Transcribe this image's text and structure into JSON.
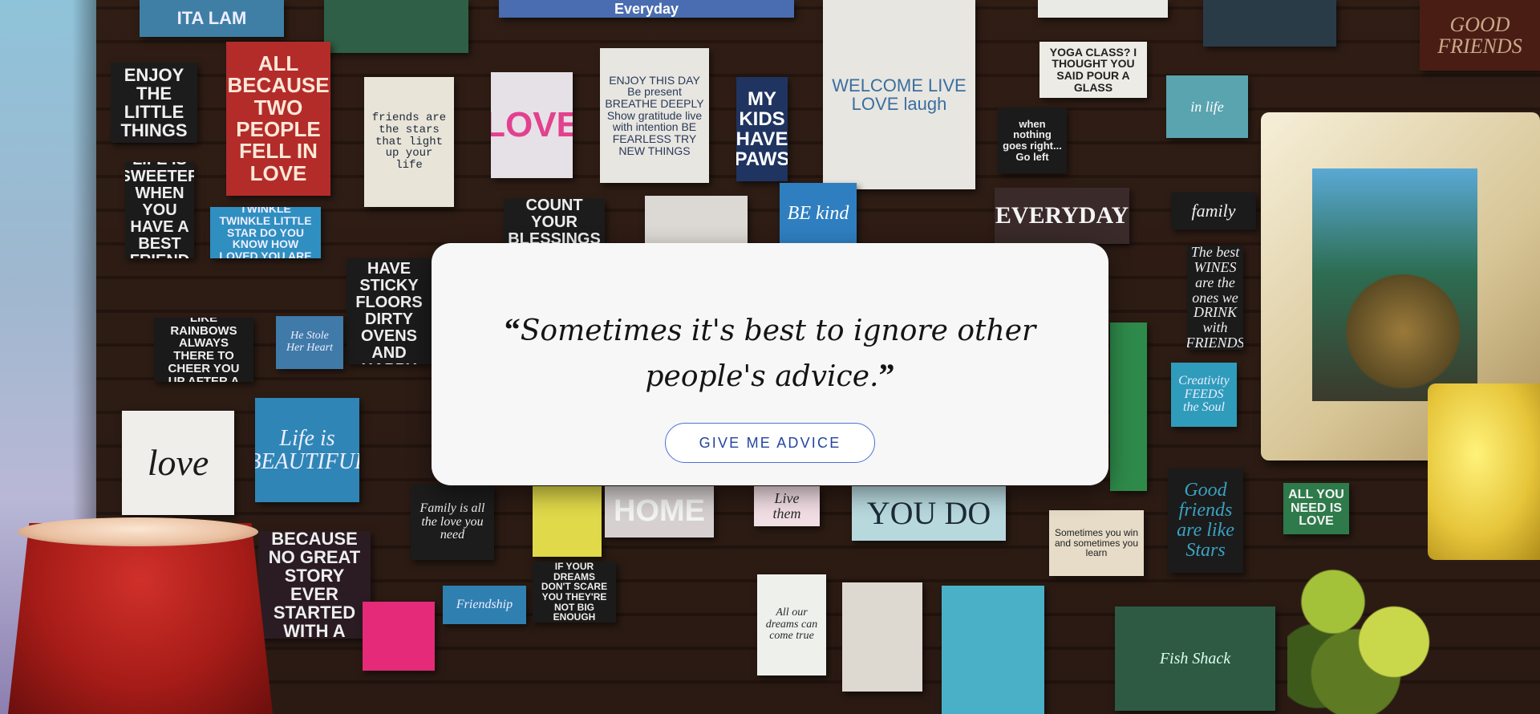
{
  "quote": {
    "open_mark": "“",
    "text": "Sometimes it's best to ignore other people's advice.",
    "close_mark": "”"
  },
  "button": {
    "label": "GIVE ME ADVICE"
  },
  "background": {
    "signs": [
      {
        "text": "ITA LAM"
      },
      {
        "text": "Everyday"
      },
      {
        "text": "ENJOY THE LITTLE THINGS"
      },
      {
        "text": "ALL BECAUSE TWO PEOPLE FELL IN LOVE"
      },
      {
        "text": "friends are the stars that light up your life"
      },
      {
        "text": "LOVE"
      },
      {
        "text": "ENJOY THIS DAY Be present BREATHE DEEPLY Show gratitude live with intention BE FEARLESS TRY NEW THINGS"
      },
      {
        "text": "MY KIDS HAVE PAWS"
      },
      {
        "text": "WELCOME LIVE LOVE laugh"
      },
      {
        "text": "YOGA CLASS? I THOUGHT YOU SAID POUR A GLASS"
      },
      {
        "text": "in life"
      },
      {
        "text": "when nothing goes right... Go left"
      },
      {
        "text": "LIFE IS SWEETER WHEN YOU HAVE A BEST FRIEND"
      },
      {
        "text": "TWINKLE TWINKLE LITTLE STAR DO YOU KNOW HOW LOVED YOU ARE"
      },
      {
        "text": "COUNT YOUR BLESSINGS"
      },
      {
        "text": "BE kind"
      },
      {
        "text": "EVERYDAY"
      },
      {
        "text": "family"
      },
      {
        "text": "GOOD MOMS HAVE STICKY FLOORS DIRTY OVENS AND HAPPY KIDS"
      },
      {
        "text": "The best WINES are the ones we DRINK with FRIENDS"
      },
      {
        "text": "FRIENDS ARE LIKE RAINBOWS ALWAYS THERE TO CHEER YOU UP AFTER A STORM"
      },
      {
        "text": "He Stole Her Heart"
      },
      {
        "text": "Creativity FEEDS the Soul"
      },
      {
        "text": "love"
      },
      {
        "text": "Life is BEAUTIFUL"
      },
      {
        "text": "Family is all the love you need"
      },
      {
        "text": "HOME"
      },
      {
        "text": "Live them"
      },
      {
        "text": "YOU DO"
      },
      {
        "text": "Sometimes you win and sometimes you learn"
      },
      {
        "text": "Good friends are like Stars"
      },
      {
        "text": "ALL YOU NEED IS LOVE"
      },
      {
        "text": "WINE BECAUSE NO GREAT STORY EVER STARTED WITH A SALAD"
      },
      {
        "text": "Friendship"
      },
      {
        "text": "IF YOUR DREAMS DON'T SCARE YOU THEY'RE NOT BIG ENOUGH"
      },
      {
        "text": "All our dreams can come true"
      },
      {
        "text": "Fish Shack"
      },
      {
        "text": "GOOD FRIENDS"
      }
    ]
  }
}
